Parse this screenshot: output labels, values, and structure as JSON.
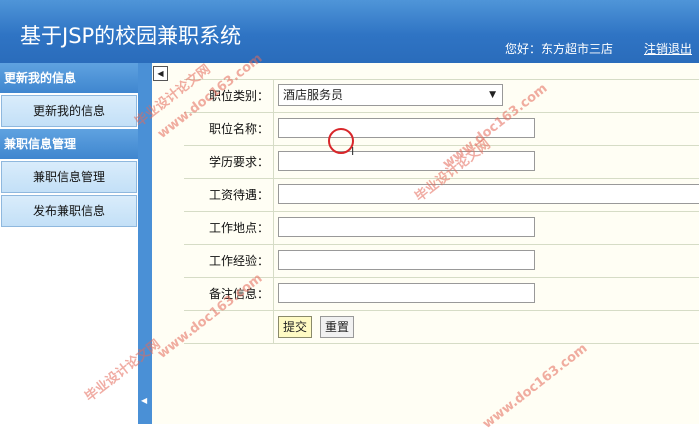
{
  "header": {
    "title": "基于JSP的校园兼职系统",
    "greeting": "您好：东方超市三店",
    "logout": "注销退出"
  },
  "sidebar": {
    "sections": [
      {
        "title": "更新我的信息",
        "items": [
          "更新我的信息"
        ]
      },
      {
        "title": "兼职信息管理",
        "items": [
          "兼职信息管理",
          "发布兼职信息"
        ]
      }
    ]
  },
  "form": {
    "category_label": "职位类别：",
    "category_value": "酒店服务员",
    "name_label": "职位名称：",
    "education_label": "学历要求：",
    "salary_label": "工资待遇：",
    "location_label": "工作地点：",
    "experience_label": "工作经验：",
    "remarks_label": "备注信息：",
    "submit_label": "提交",
    "reset_label": "重置"
  },
  "watermark": {
    "line1": "毕业设计论文网",
    "line2": "www.doc163.com"
  }
}
